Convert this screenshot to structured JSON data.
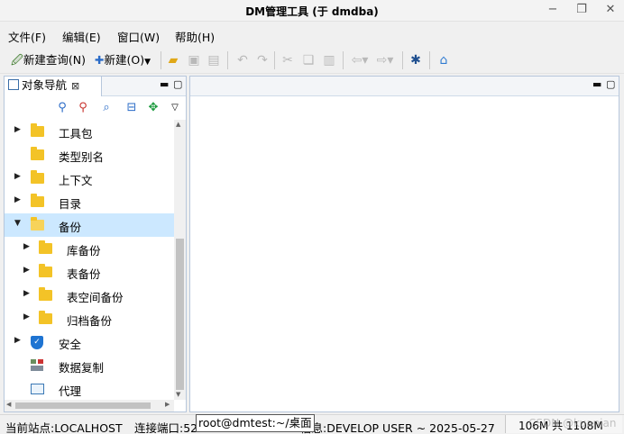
{
  "window": {
    "title": "DM管理工具 (于 dmdba)",
    "minimize_glyph": "−",
    "restore_glyph": "❐",
    "close_glyph": "✕"
  },
  "menu": [
    "文件(F)",
    "编辑(E)",
    "窗口(W)",
    "帮助(H)"
  ],
  "toolbar": {
    "new_query": "新建查询(N)",
    "new": "新建(O)"
  },
  "navigator": {
    "tab_label": "对象导航",
    "tree": [
      {
        "label": "工具包",
        "icon": "folder-icon",
        "expand": "collapsed",
        "level": 0
      },
      {
        "label": "类型别名",
        "icon": "folder-icon",
        "expand": "none",
        "level": 0
      },
      {
        "label": "上下文",
        "icon": "folder-icon",
        "expand": "collapsed",
        "level": 0
      },
      {
        "label": "目录",
        "icon": "folder-icon",
        "expand": "collapsed",
        "level": 0
      },
      {
        "label": "备份",
        "icon": "folder-open-icon",
        "expand": "expanded",
        "level": 0,
        "selected": true
      },
      {
        "label": "库备份",
        "icon": "folder-icon",
        "expand": "collapsed",
        "level": 1
      },
      {
        "label": "表备份",
        "icon": "folder-icon",
        "expand": "collapsed",
        "level": 1
      },
      {
        "label": "表空间备份",
        "icon": "folder-icon",
        "expand": "collapsed",
        "level": 1
      },
      {
        "label": "归档备份",
        "icon": "folder-icon",
        "expand": "collapsed",
        "level": 1
      },
      {
        "label": "安全",
        "icon": "shield-icon",
        "expand": "collapsed",
        "level": 0
      },
      {
        "label": "数据复制",
        "icon": "replication-icon",
        "expand": "none",
        "level": 0
      },
      {
        "label": "代理",
        "icon": "proxy-icon",
        "expand": "none",
        "level": 0
      }
    ]
  },
  "status": {
    "site": "当前站点:LOCALHOST",
    "port": "连接端口:52",
    "terminal_tooltip": "root@dmtest:~/桌面",
    "info": "信息:DEVELOP USER ~ 2025-05-27",
    "memory": "106M 共 1108M"
  },
  "watermark": "CSDN @kuanian"
}
